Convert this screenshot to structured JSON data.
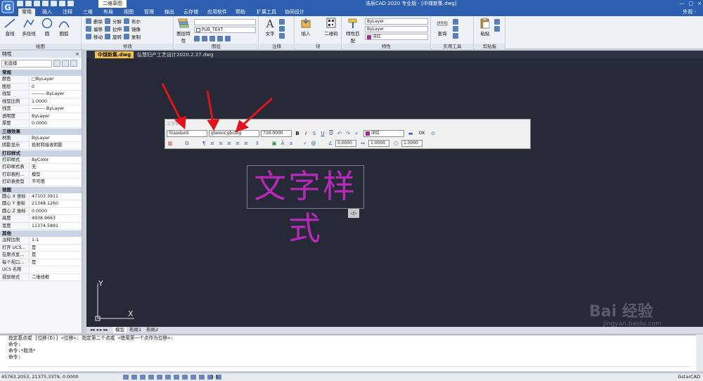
{
  "titlebar": {
    "active_doc_tab": "二维草图",
    "app_title": "浩辰CAD 2020 专业版 - [中煤新集.dwg]",
    "win_min": "—",
    "win_max": "□",
    "win_close": "×"
  },
  "menu_tabs": [
    "常用",
    "插入",
    "注释",
    "三维",
    "布局",
    "视图",
    "管理",
    "输出",
    "云存储",
    "应用软件",
    "帮助",
    "扩展工具",
    "协同设计"
  ],
  "menu_right": "外观 -",
  "ribbon": {
    "draw": {
      "label": "绘图",
      "buttons": [
        "直线",
        "多段线",
        "圆",
        "圆弧"
      ]
    },
    "modify": {
      "label": "修改",
      "rows": [
        [
          "删除",
          "分解",
          "布尔"
        ],
        [
          "偏移",
          "拉伸",
          "镜像"
        ],
        [
          "移动",
          "旋转",
          "复制"
        ]
      ]
    },
    "layer": {
      "label": "图层",
      "big_button": "图层特性",
      "layer_combo": "PUB_TEXT"
    },
    "annot": {
      "label": "注释",
      "big_button": "文字"
    },
    "block": {
      "label": "块",
      "buttons": [
        "插入",
        "二维码"
      ]
    },
    "props": {
      "label": "特性",
      "big_button": "特性匹配",
      "combo1": "ByLayer",
      "combo2": "ByLayer",
      "color_combo": "洋红",
      "color": "#e000e0"
    },
    "tools": {
      "label": "实用工具",
      "big_button": "查询"
    },
    "clipboard": {
      "label": "剪贴板",
      "big_button": "粘贴"
    }
  },
  "doc_tabs": [
    "中煤新集.dwg",
    "弘慧妇产工艺设计2020.2.27.dwg"
  ],
  "props_panel": {
    "title": "特性",
    "close": "× ",
    "selection": "无选择",
    "categories": [
      {
        "name": "常规",
        "rows": [
          [
            "颜色",
            "□ByLayer"
          ],
          [
            "图层",
            "0"
          ],
          [
            "线型",
            "——— ByLayer"
          ],
          [
            "线型比例",
            "1.0000"
          ],
          [
            "线宽",
            "——— ByLayer"
          ],
          [
            "透明度",
            "ByLayer"
          ],
          [
            "厚度",
            "0.0000"
          ]
        ]
      },
      {
        "name": "三维效果",
        "rows": [
          [
            "材质",
            "ByLayer"
          ],
          [
            "阴影显示",
            "投射和接收阴影"
          ]
        ]
      },
      {
        "name": "打印样式",
        "rows": [
          [
            "打印样式",
            "ByColor"
          ],
          [
            "打印样式表",
            "无"
          ],
          [
            "打印表附...",
            "模型"
          ],
          [
            "打印表类型",
            "不可用"
          ]
        ]
      },
      {
        "name": "视图",
        "rows": [
          [
            "圆心 X 坐标",
            "47103.3911"
          ],
          [
            "圆心 Y 坐标",
            "21348.1260"
          ],
          [
            "圆心 Z 坐标",
            "0.0000"
          ],
          [
            "高度",
            "4938.9663"
          ],
          [
            "宽度",
            "11374.5891"
          ]
        ]
      },
      {
        "name": "其他",
        "rows": [
          [
            "注释比例",
            "1:1"
          ],
          [
            "打开 UCS...",
            "是"
          ],
          [
            "在原点显...",
            "是"
          ],
          [
            "每个视口...",
            "是"
          ],
          [
            "UCS 名称",
            ""
          ],
          [
            "视觉样式",
            "二维线框"
          ]
        ]
      }
    ]
  },
  "text_toolbar": {
    "title": "文字格式",
    "style_combo": "Standard",
    "font_combo": "gbenor,gbcbig",
    "height_combo": "750.0000",
    "color_combo": "洋红",
    "ok": "OK",
    "oblique": "0.0000",
    "tracking": "1.0000",
    "width": "1.0000"
  },
  "canvas": {
    "mtext": "文字样式",
    "mtext_color": "#c42ac6",
    "ucs_y": "Y",
    "ucs_x": "X"
  },
  "layout_tabs": [
    "模型",
    "布局1",
    "布局2"
  ],
  "command": {
    "lines": [
      "指定基点或 [位移(D)] <位移>:  指定第二个点或 <使用第一个点作为位移>:",
      "命令:",
      "命令:*取消*",
      "命令:"
    ]
  },
  "status": {
    "coords": "45763.2053, 21375.3379, 0.0000",
    "scale": "1:1",
    "product": "GstarCAD"
  }
}
